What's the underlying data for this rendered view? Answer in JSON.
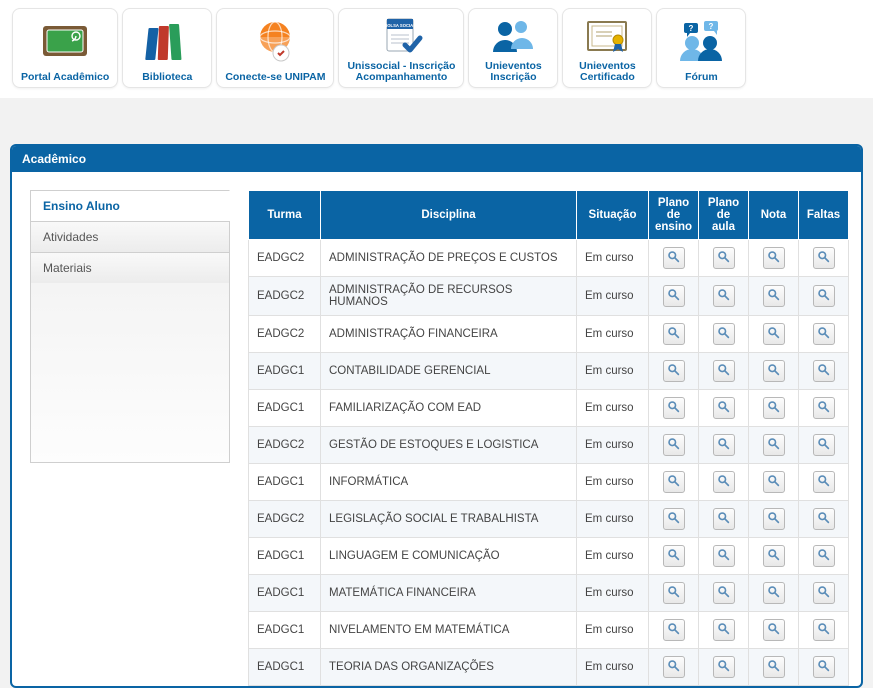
{
  "topnav": [
    {
      "id": "portal-academico",
      "label": "Portal Acadêmico"
    },
    {
      "id": "biblioteca",
      "label": "Biblioteca"
    },
    {
      "id": "conecte-se-unipam",
      "label": "Conecte-se UNIPAM"
    },
    {
      "id": "unissocial",
      "label": "Unissocial - Inscrição\nAcompanhamento"
    },
    {
      "id": "unieventos-insc",
      "label": "Unieventos\nInscrição"
    },
    {
      "id": "unieventos-cert",
      "label": "Unieventos\nCertificado"
    },
    {
      "id": "forum",
      "label": "Fórum"
    }
  ],
  "panel": {
    "title": "Acadêmico"
  },
  "sidetabs": [
    {
      "id": "ensino-aluno",
      "label": "Ensino Aluno",
      "active": true
    },
    {
      "id": "atividades",
      "label": "Atividades",
      "active": false
    },
    {
      "id": "materiais",
      "label": "Materiais",
      "active": false
    }
  ],
  "table": {
    "headers": {
      "turma": "Turma",
      "disciplina": "Disciplina",
      "situacao": "Situação",
      "plano_ensino": "Plano de ensino",
      "plano_aula": "Plano de aula",
      "nota": "Nota",
      "faltas": "Faltas"
    },
    "rows": [
      {
        "turma": "EADGC2",
        "disciplina": "ADMINISTRAÇÃO DE PREÇOS E CUSTOS",
        "situacao": "Em curso"
      },
      {
        "turma": "EADGC2",
        "disciplina": "ADMINISTRAÇÃO DE RECURSOS HUMANOS",
        "situacao": "Em curso"
      },
      {
        "turma": "EADGC2",
        "disciplina": "ADMINISTRAÇÃO FINANCEIRA",
        "situacao": "Em curso"
      },
      {
        "turma": "EADGC1",
        "disciplina": "CONTABILIDADE GERENCIAL",
        "situacao": "Em curso"
      },
      {
        "turma": "EADGC1",
        "disciplina": "FAMILIARIZAÇÃO COM EAD",
        "situacao": "Em curso"
      },
      {
        "turma": "EADGC2",
        "disciplina": "GESTÃO DE ESTOQUES E LOGISTICA",
        "situacao": "Em curso"
      },
      {
        "turma": "EADGC1",
        "disciplina": "INFORMÁTICA",
        "situacao": "Em curso"
      },
      {
        "turma": "EADGC2",
        "disciplina": "LEGISLAÇÃO SOCIAL E TRABALHISTA",
        "situacao": "Em curso"
      },
      {
        "turma": "EADGC1",
        "disciplina": "LINGUAGEM E COMUNICAÇÃO",
        "situacao": "Em curso"
      },
      {
        "turma": "EADGC1",
        "disciplina": "MATEMÁTICA FINANCEIRA",
        "situacao": "Em curso"
      },
      {
        "turma": "EADGC1",
        "disciplina": "NIVELAMENTO EM MATEMÁTICA",
        "situacao": "Em curso"
      },
      {
        "turma": "EADGC1",
        "disciplina": "TEORIA DAS ORGANIZAÇÕES",
        "situacao": "Em curso"
      }
    ]
  }
}
